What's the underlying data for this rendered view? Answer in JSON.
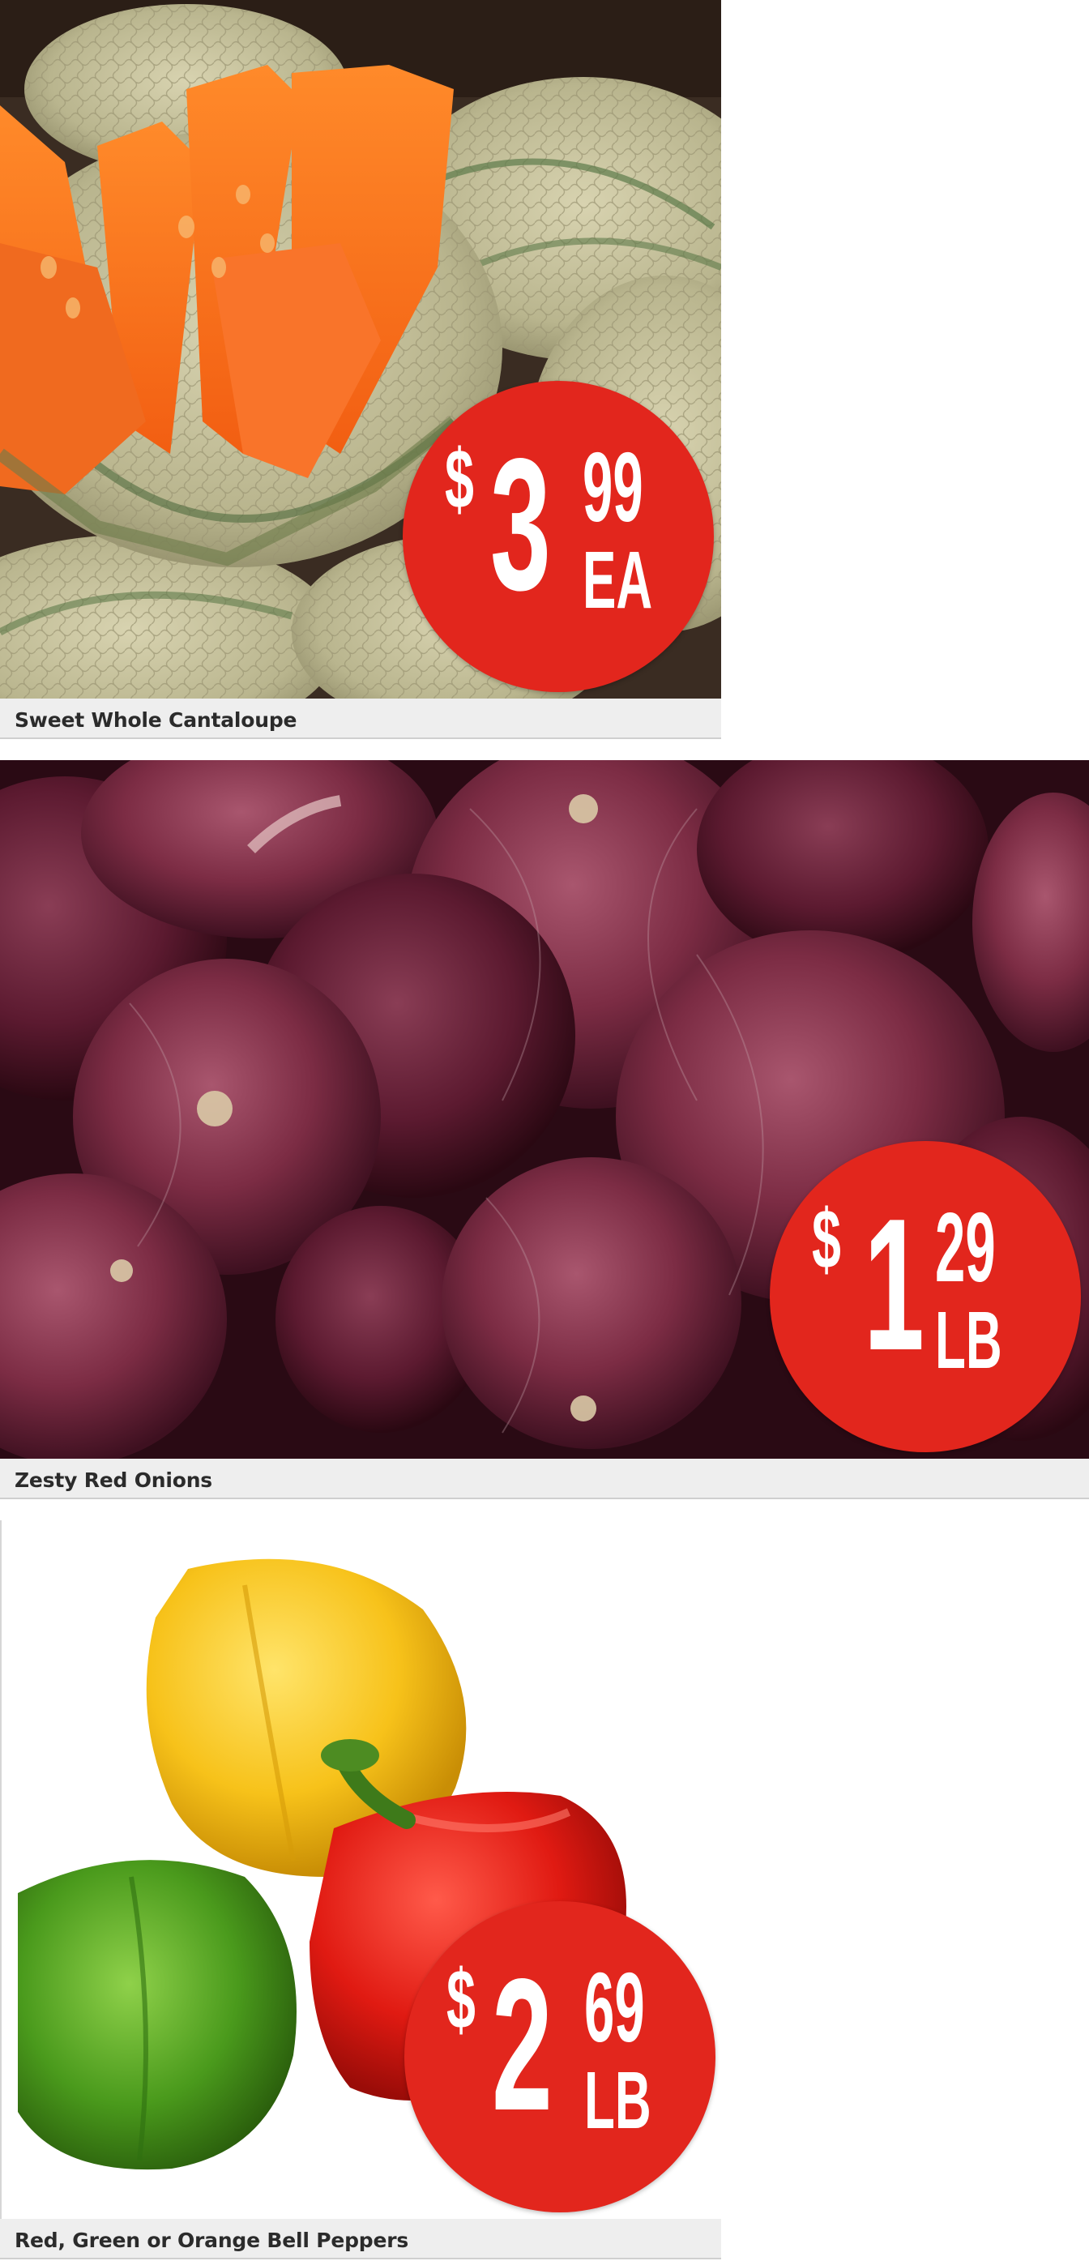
{
  "products": [
    {
      "name": "Sweet Whole Cantaloupe",
      "price": {
        "currency": "$",
        "dollars": "3",
        "cents": "99",
        "unit": "EA"
      },
      "image": "cantaloupe-photo"
    },
    {
      "name": "Zesty Red Onions",
      "price": {
        "currency": "$",
        "dollars": "1",
        "cents": "29",
        "unit": "LB"
      },
      "image": "red-onions-photo"
    },
    {
      "name": "Red, Green or Orange Bell Peppers",
      "price": {
        "currency": "$",
        "dollars": "2",
        "cents": "69",
        "unit": "LB"
      },
      "image": "bell-peppers-photo"
    }
  ],
  "colors": {
    "badge_red": "#e2261d",
    "caption_bg": "#eeeeee",
    "caption_text": "#2b2b2b"
  }
}
